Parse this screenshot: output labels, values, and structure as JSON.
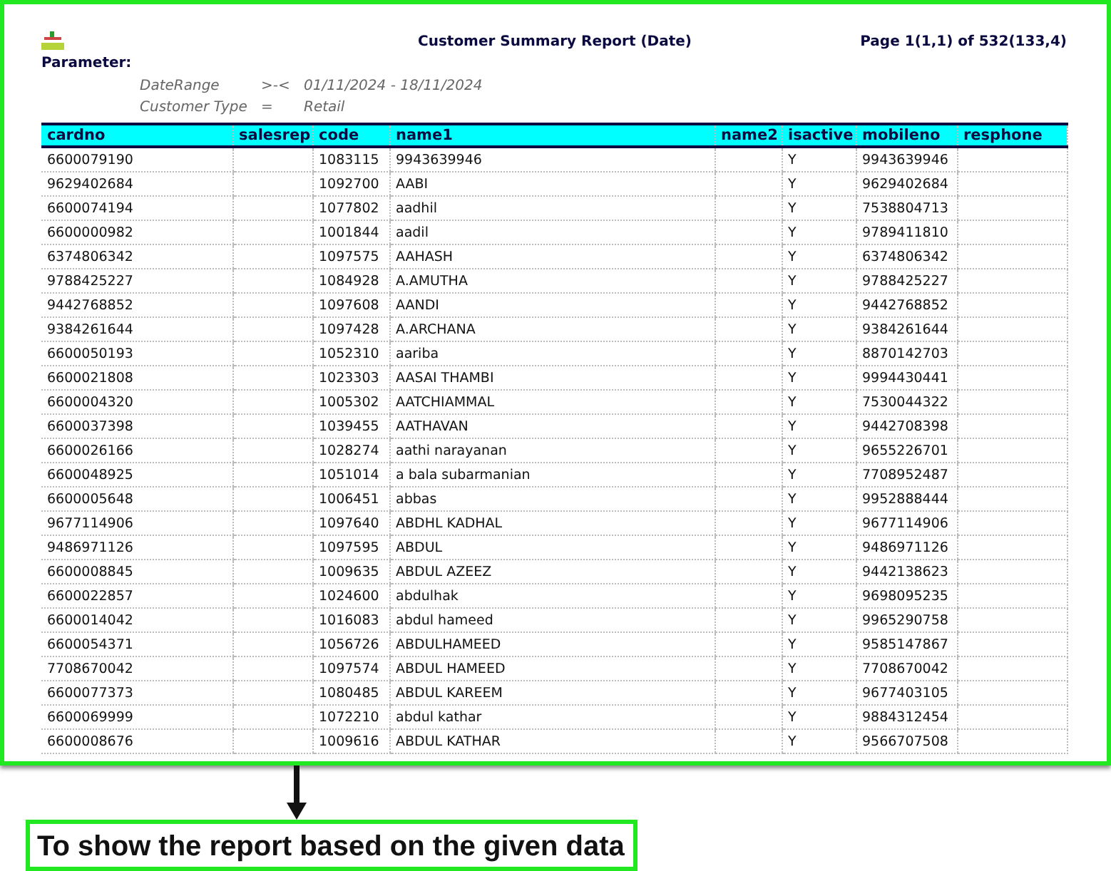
{
  "report": {
    "title": "Customer Summary Report (Date)",
    "page_info": "Page 1(1,1) of 532(133,4)",
    "parameter_heading": "Parameter:",
    "parameters": [
      {
        "name": "DateRange",
        "operator": ">-<",
        "value": "01/11/2024 - 18/11/2024"
      },
      {
        "name": "Customer Type",
        "operator": "=",
        "value": "Retail"
      }
    ]
  },
  "table": {
    "columns": [
      "cardno",
      "salesrep",
      "code",
      "name1",
      "name2",
      "isactive",
      "mobileno",
      "resphone"
    ],
    "rows": [
      {
        "cardno": "6600079190",
        "code": "1083115",
        "name1": "9943639946",
        "isactive": "Y",
        "mobileno": "9943639946"
      },
      {
        "cardno": "9629402684",
        "code": "1092700",
        "name1": "AABI",
        "isactive": "Y",
        "mobileno": "9629402684"
      },
      {
        "cardno": "6600074194",
        "code": "1077802",
        "name1": "aadhil",
        "isactive": "Y",
        "mobileno": "7538804713"
      },
      {
        "cardno": "6600000982",
        "code": "1001844",
        "name1": "aadil",
        "isactive": "Y",
        "mobileno": "9789411810"
      },
      {
        "cardno": "6374806342",
        "code": "1097575",
        "name1": "AAHASH",
        "isactive": "Y",
        "mobileno": "6374806342"
      },
      {
        "cardno": "9788425227",
        "code": "1084928",
        "name1": "A.AMUTHA",
        "isactive": "Y",
        "mobileno": "9788425227"
      },
      {
        "cardno": "9442768852",
        "code": "1097608",
        "name1": "AANDI",
        "isactive": "Y",
        "mobileno": "9442768852"
      },
      {
        "cardno": "9384261644",
        "code": "1097428",
        "name1": "A.ARCHANA",
        "isactive": "Y",
        "mobileno": "9384261644"
      },
      {
        "cardno": "6600050193",
        "code": "1052310",
        "name1": "aariba",
        "isactive": "Y",
        "mobileno": "8870142703"
      },
      {
        "cardno": "6600021808",
        "code": "1023303",
        "name1": "AASAI THAMBI",
        "isactive": "Y",
        "mobileno": "9994430441"
      },
      {
        "cardno": "6600004320",
        "code": "1005302",
        "name1": "AATCHIAMMAL",
        "isactive": "Y",
        "mobileno": "7530044322"
      },
      {
        "cardno": "6600037398",
        "code": "1039455",
        "name1": "AATHAVAN",
        "isactive": "Y",
        "mobileno": "9442708398"
      },
      {
        "cardno": "6600026166",
        "code": "1028274",
        "name1": "aathi narayanan",
        "isactive": "Y",
        "mobileno": "9655226701"
      },
      {
        "cardno": "6600048925",
        "code": "1051014",
        "name1": "a bala subarmanian",
        "isactive": "Y",
        "mobileno": "7708952487"
      },
      {
        "cardno": "6600005648",
        "code": "1006451",
        "name1": "abbas",
        "isactive": "Y",
        "mobileno": "9952888444"
      },
      {
        "cardno": "9677114906",
        "code": "1097640",
        "name1": "ABDHL KADHAL",
        "isactive": "Y",
        "mobileno": "9677114906"
      },
      {
        "cardno": "9486971126",
        "code": "1097595",
        "name1": "ABDUL",
        "isactive": "Y",
        "mobileno": "9486971126"
      },
      {
        "cardno": "6600008845",
        "code": "1009635",
        "name1": "ABDUL AZEEZ",
        "isactive": "Y",
        "mobileno": "9442138623"
      },
      {
        "cardno": "6600022857",
        "code": "1024600",
        "name1": "abdulhak",
        "isactive": "Y",
        "mobileno": "9698095235"
      },
      {
        "cardno": "6600014042",
        "code": "1016083",
        "name1": "abdul hameed",
        "isactive": "Y",
        "mobileno": "9965290758"
      },
      {
        "cardno": "6600054371",
        "code": "1056726",
        "name1": "ABDULHAMEED",
        "isactive": "Y",
        "mobileno": "9585147867"
      },
      {
        "cardno": "7708670042",
        "code": "1097574",
        "name1": "ABDUL HAMEED",
        "isactive": "Y",
        "mobileno": "7708670042"
      },
      {
        "cardno": "6600077373",
        "code": "1080485",
        "name1": "ABDUL KAREEM",
        "isactive": "Y",
        "mobileno": "9677403105"
      },
      {
        "cardno": "6600069999",
        "code": "1072210",
        "name1": "abdul kathar",
        "isactive": "Y",
        "mobileno": "9884312454"
      },
      {
        "cardno": "6600008676",
        "code": "1009616",
        "name1": "ABDUL KATHAR",
        "isactive": "Y",
        "mobileno": "9566707508"
      }
    ]
  },
  "caption": "To show the report based on the given data"
}
